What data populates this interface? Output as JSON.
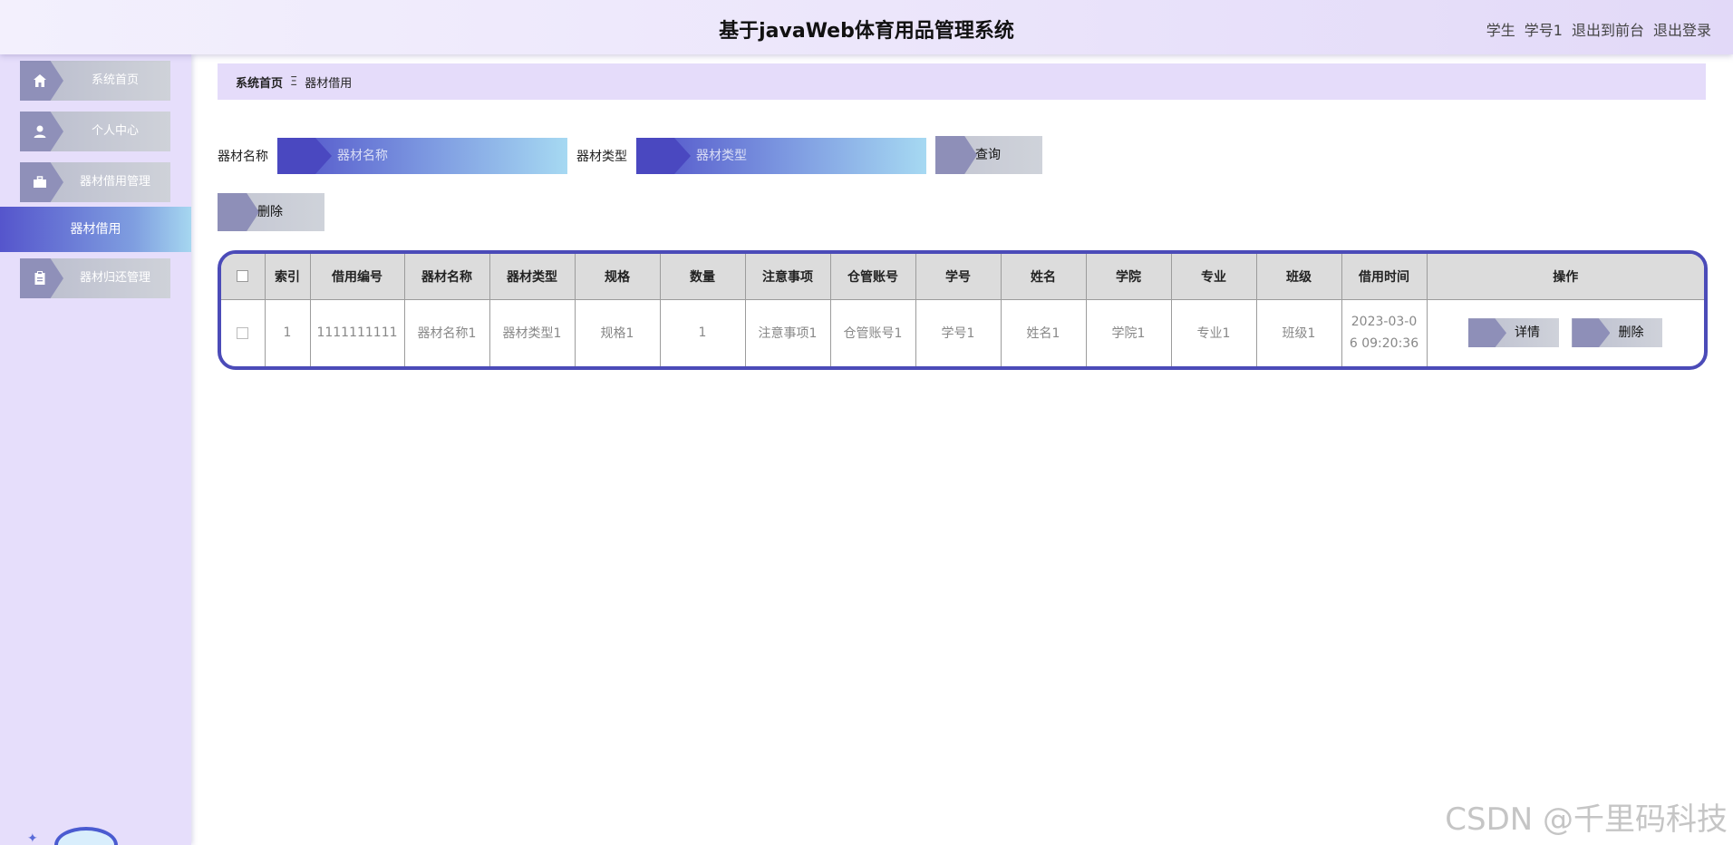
{
  "header": {
    "title": "基于javaWeb体育用品管理系统",
    "user_role": "学生",
    "user_name": "学号1",
    "back_to_front": "退出到前台",
    "logout": "退出登录"
  },
  "sidebar": {
    "items": [
      {
        "label": "系统首页",
        "icon": "home-icon"
      },
      {
        "label": "个人中心",
        "icon": "user-icon"
      },
      {
        "label": "器材借用管理",
        "icon": "briefcase-icon"
      },
      {
        "label": "器材借用",
        "active": true
      },
      {
        "label": "器材归还管理",
        "icon": "clipboard-icon"
      }
    ]
  },
  "breadcrumb": {
    "home": "系统首页",
    "separator": "Ξ",
    "current": "器材借用"
  },
  "search": {
    "name_label": "器材名称",
    "name_placeholder": "器材名称",
    "type_label": "器材类型",
    "type_placeholder": "器材类型",
    "query_button": "查询",
    "delete_button": "删除"
  },
  "table": {
    "columns": [
      "索引",
      "借用编号",
      "器材名称",
      "器材类型",
      "规格",
      "数量",
      "注意事项",
      "仓管账号",
      "学号",
      "姓名",
      "学院",
      "专业",
      "班级",
      "借用时间",
      "操作"
    ],
    "rows": [
      {
        "index": "1",
        "borrow_no": "1111111111",
        "name": "器材名称1",
        "type": "器材类型1",
        "spec": "规格1",
        "quantity": "1",
        "notes": "注意事项1",
        "keeper": "仓管账号1",
        "student_no": "学号1",
        "student_name": "姓名1",
        "college": "学院1",
        "major": "专业1",
        "class": "班级1",
        "time_line1": "2023-03-0",
        "time_line2": "6 09:20:36",
        "detail_button": "详情",
        "delete_button": "删除"
      }
    ]
  },
  "watermark": "CSDN @千里码科技",
  "colors": {
    "accent": "#4b4bb8",
    "sidebar_bg": "#e6defb",
    "tag": "#8e8fb8"
  }
}
